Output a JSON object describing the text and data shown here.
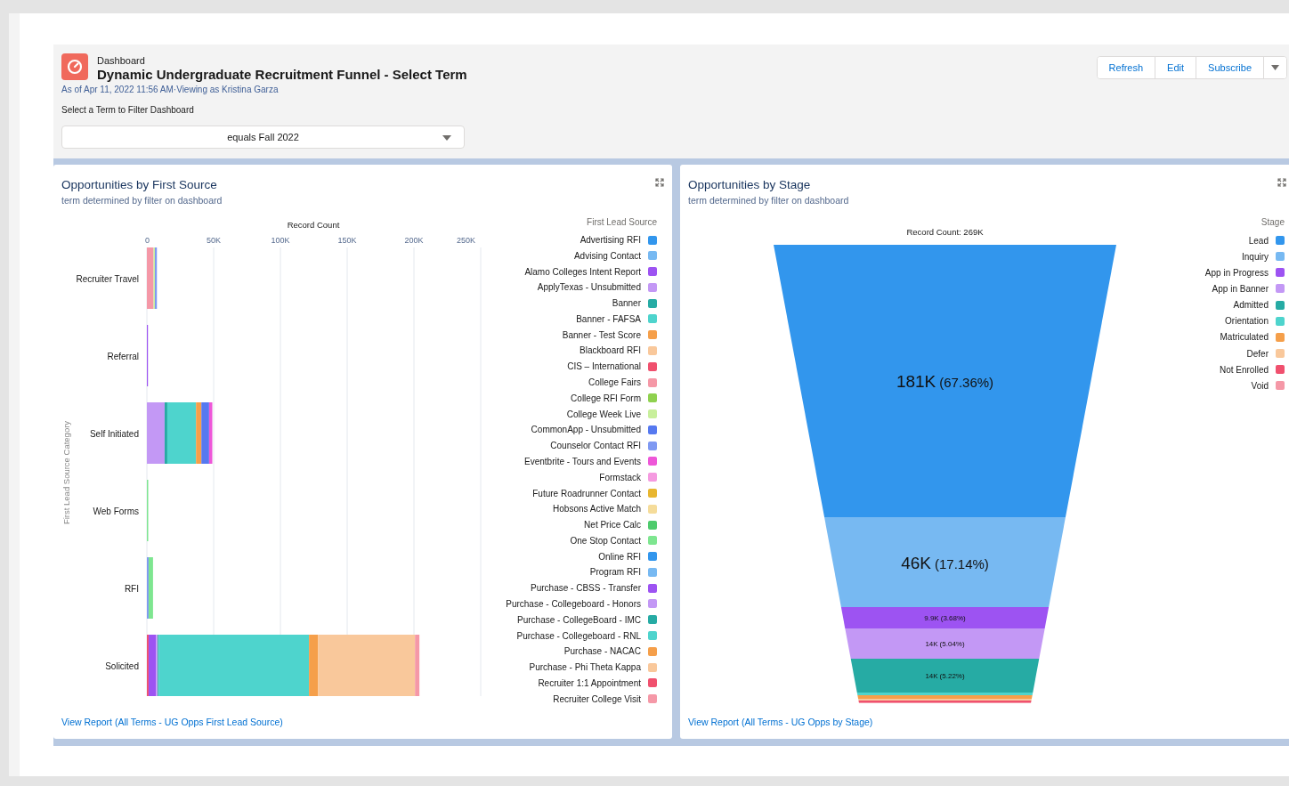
{
  "header": {
    "breadcrumb": "Dashboard",
    "title": "Dynamic Undergraduate Recruitment Funnel - Select Term",
    "timestamp": "As of Apr 11, 2022 11:56 AM·Viewing as Kristina Garza",
    "filter": {
      "label": "Select a Term to Filter Dashboard",
      "value": "equals Fall 2022"
    },
    "buttons": [
      "Refresh",
      "Edit",
      "Subscribe"
    ]
  },
  "cards": [
    {
      "kind": "bar_chart",
      "title": "Opportunities by First Source",
      "subtitle": "term determined by filter on dashboard",
      "legend_title": "First Lead Source",
      "chart_data": {
        "type": "bar",
        "orientation": "horizontal",
        "stacked": true,
        "grid": true,
        "xlabel": "Record Count",
        "ylabel": "First Lead Source Category",
        "categories": [
          "Recruiter Travel",
          "Referral",
          "Self Initiated",
          "Web Forms",
          "RFI",
          "Solicited"
        ],
        "xlim": [
          0,
          250
        ],
        "xticks": [
          {
            "value": 0,
            "label": "0"
          },
          {
            "value": 50,
            "label": "50K"
          },
          {
            "value": 100,
            "label": "100K"
          },
          {
            "value": 150,
            "label": "150K"
          },
          {
            "value": 200,
            "label": "200K"
          },
          {
            "value": 250,
            "label": "250K"
          }
        ],
        "series": [
          {
            "name": "Advertising RFI",
            "color": "#3296ed",
            "values": [
              null,
              null,
              null,
              null,
              null,
              null
            ]
          },
          {
            "name": "Advising Contact",
            "color": "#77b9f2",
            "values": [
              null,
              null,
              null,
              null,
              null,
              null
            ]
          },
          {
            "name": "Alamo Colleges Intent Report",
            "color": "#9d53f2",
            "values": [
              null,
              0.5,
              null,
              null,
              null,
              null
            ]
          },
          {
            "name": "ApplyTexas - Unsubmitted",
            "color": "#c398f5",
            "values": [
              null,
              null,
              13.3,
              null,
              null,
              null
            ]
          },
          {
            "name": "Banner",
            "color": "#26aba4",
            "values": [
              null,
              null,
              2,
              null,
              null,
              null
            ]
          },
          {
            "name": "Banner - FAFSA",
            "color": "#4ed4cd",
            "values": [
              null,
              null,
              21.5,
              null,
              null,
              null
            ]
          },
          {
            "name": "Banner - Test Score",
            "color": "#f59f4a",
            "values": [
              null,
              null,
              4,
              null,
              null,
              null
            ]
          },
          {
            "name": "Blackboard RFI",
            "color": "#f9c89b",
            "values": [
              null,
              null,
              null,
              null,
              null,
              null
            ]
          },
          {
            "name": "CIS – International",
            "color": "#f0506e",
            "values": [
              null,
              null,
              null,
              null,
              null,
              1.3
            ]
          },
          {
            "name": "College Fairs",
            "color": "#f598a7",
            "values": [
              5,
              null,
              null,
              null,
              null,
              null
            ]
          },
          {
            "name": "College RFI Form",
            "color": "#8fd14f",
            "values": [
              null,
              null,
              null,
              null,
              null,
              null
            ]
          },
          {
            "name": "College Week Live",
            "color": "#c8ef9b",
            "values": [
              1,
              null,
              null,
              null,
              null,
              null
            ]
          },
          {
            "name": "CommonApp - Unsubmitted",
            "color": "#5679f0",
            "values": [
              null,
              null,
              5.8,
              null,
              null,
              null
            ]
          },
          {
            "name": "Counselor Contact RFI",
            "color": "#7f99f2",
            "values": [
              1.5,
              null,
              null,
              null,
              1.3,
              null
            ]
          },
          {
            "name": "Eventbrite - Tours and Events",
            "color": "#ee57d8",
            "values": [
              null,
              null,
              2.4,
              null,
              null,
              null
            ]
          },
          {
            "name": "Formstack",
            "color": "#f59ae0",
            "values": [
              null,
              null,
              null,
              null,
              null,
              null
            ]
          },
          {
            "name": "Future Roadrunner Contact",
            "color": "#e8b630",
            "values": [
              null,
              null,
              null,
              null,
              null,
              null
            ]
          },
          {
            "name": "Hobsons Active Match",
            "color": "#f5dc9a",
            "values": [
              null,
              null,
              null,
              null,
              null,
              null
            ]
          },
          {
            "name": "Net Price Calc",
            "color": "#4ecb6d",
            "values": [
              null,
              null,
              null,
              null,
              null,
              null
            ]
          },
          {
            "name": "One Stop Contact",
            "color": "#7ee690",
            "values": [
              null,
              null,
              null,
              1,
              3.3,
              null
            ]
          },
          {
            "name": "Online RFI",
            "color": "#3296ed",
            "values": [
              null,
              null,
              null,
              null,
              null,
              null
            ]
          },
          {
            "name": "Program RFI",
            "color": "#77b9f2",
            "values": [
              null,
              null,
              null,
              null,
              null,
              null
            ]
          },
          {
            "name": "Purchase - CBSS - Transfer",
            "color": "#9d53f2",
            "values": [
              null,
              null,
              null,
              null,
              null,
              5.5
            ]
          },
          {
            "name": "Purchase - Collegeboard - Honors",
            "color": "#c398f5",
            "values": [
              null,
              null,
              null,
              null,
              null,
              1.3
            ]
          },
          {
            "name": "Purchase - CollegeBoard - IMC",
            "color": "#26aba4",
            "values": [
              null,
              null,
              null,
              null,
              null,
              0.9
            ]
          },
          {
            "name": "Purchase - Collegeboard - RNL",
            "color": "#4ed4cd",
            "values": [
              null,
              null,
              null,
              null,
              null,
              112.4
            ]
          },
          {
            "name": "Purchase - NACAC",
            "color": "#f59f4a",
            "values": [
              null,
              null,
              null,
              null,
              null,
              6.7
            ]
          },
          {
            "name": "Purchase - Phi Theta Kappa",
            "color": "#f9c89b",
            "values": [
              null,
              null,
              null,
              null,
              null,
              72.7
            ]
          },
          {
            "name": "Recruiter 1:1 Appointment",
            "color": "#f0506e",
            "values": [
              null,
              null,
              null,
              null,
              null,
              null
            ]
          },
          {
            "name": "Recruiter College Visit",
            "color": "#f598a7",
            "values": [
              null,
              null,
              null,
              null,
              null,
              3.3
            ]
          }
        ]
      },
      "footer_link": "View Report (All Terms - UG Opps First Lead Source)"
    },
    {
      "kind": "funnel",
      "title": "Opportunities by Stage",
      "subtitle": "term determined by filter on dashboard",
      "legend_title": "Stage",
      "record_count": "Record Count: 269K",
      "stages": [
        {
          "name": "Lead",
          "color": "#3296ed",
          "kind": "large",
          "value_label": "181K",
          "share_label": "(67.36%)"
        },
        {
          "name": "Inquiry",
          "color": "#77b9f2",
          "kind": "large",
          "value_label": "46K",
          "share_label": "(17.14%)"
        },
        {
          "name": "App in Progress",
          "color": "#9d53f2",
          "kind": "small",
          "value_label": "9.9K",
          "share_label": "(3.68%)"
        },
        {
          "name": "App in Banner",
          "color": "#c398f5",
          "kind": "small",
          "value_label": "14K",
          "share_label": "(5.04%)"
        },
        {
          "name": "Admitted",
          "color": "#26aba4",
          "kind": "small",
          "value_label": "14K",
          "share_label": "(5.22%)"
        },
        {
          "name": "Orientation",
          "color": "#4ed4cd"
        },
        {
          "name": "Matriculated",
          "color": "#f59f4a"
        },
        {
          "name": "Defer",
          "color": "#f9c89b"
        },
        {
          "name": "Not Enrolled",
          "color": "#f0506e"
        },
        {
          "name": "Void",
          "color": "#f598a7"
        }
      ],
      "footer_link": "View Report (All Terms - UG Opps by Stage)"
    }
  ]
}
